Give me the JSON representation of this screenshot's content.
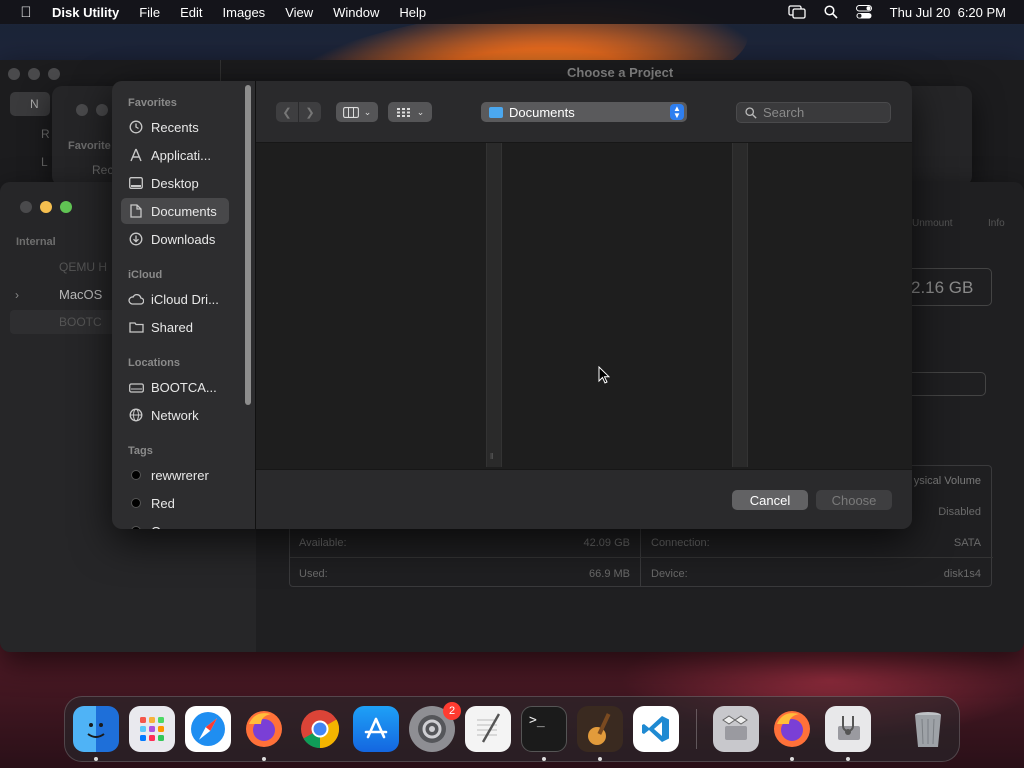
{
  "menubar": {
    "app_name": "Disk Utility",
    "menus": [
      "File",
      "Edit",
      "Images",
      "View",
      "Window",
      "Help"
    ],
    "datetime": "Thu Jul 20  6:20 PM"
  },
  "background": {
    "project_window_title": "Choose a Project",
    "bg_sidebar_letters": [
      "N",
      "R",
      "L"
    ],
    "bg_favorites": "Favorite",
    "bg_recents": "Rec",
    "disk_utility": {
      "sidebar_section": "Internal",
      "items": [
        "QEMU H",
        "MacOS",
        "BOOTC"
      ],
      "toolbar_labels": [
        "Unmount",
        "Info"
      ],
      "capacity": "2.16 GB",
      "volume_type": "ysical Volume",
      "rows": [
        {
          "label": "",
          "value": "",
          "label2": "",
          "value2": "Disabled"
        },
        {
          "label": "Available:",
          "value": "42.09 GB",
          "label2": "Connection:",
          "value2": "SATA"
        },
        {
          "label": "Used:",
          "value": "66.9 MB",
          "label2": "Device:",
          "value2": "disk1s4"
        }
      ]
    }
  },
  "dialog": {
    "sidebar": {
      "favorites_header": "Favorites",
      "favorites": [
        {
          "label": "Recents",
          "icon": "clock-icon"
        },
        {
          "label": "Applicati...",
          "icon": "applications-icon"
        },
        {
          "label": "Desktop",
          "icon": "desktop-icon"
        },
        {
          "label": "Documents",
          "icon": "document-icon",
          "selected": true
        },
        {
          "label": "Downloads",
          "icon": "download-icon"
        }
      ],
      "icloud_header": "iCloud",
      "icloud": [
        {
          "label": "iCloud Dri...",
          "icon": "cloud-icon"
        },
        {
          "label": "Shared",
          "icon": "shared-folder-icon"
        }
      ],
      "locations_header": "Locations",
      "locations": [
        {
          "label": "BOOTCA...",
          "icon": "disk-icon"
        },
        {
          "label": "Network",
          "icon": "network-icon"
        }
      ],
      "tags_header": "Tags",
      "tags": [
        {
          "label": "rewwrerer",
          "color": "#000000"
        },
        {
          "label": "Red",
          "color": "#000000"
        },
        {
          "label": "O",
          "color": "#000000"
        }
      ]
    },
    "toolbar": {
      "location": "Documents",
      "search_placeholder": "Search"
    },
    "buttons": {
      "cancel": "Cancel",
      "choose": "Choose"
    }
  },
  "dock": {
    "apps": [
      "Finder",
      "Launchpad",
      "Safari",
      "Firefox",
      "Chrome",
      "App Store",
      "System Settings",
      "TextEdit",
      "Terminal",
      "GarageBand",
      "VS Code",
      "Boot Camp Assistant",
      "Firefox",
      "Disk Utility",
      "Trash"
    ],
    "settings_badge": "2"
  }
}
